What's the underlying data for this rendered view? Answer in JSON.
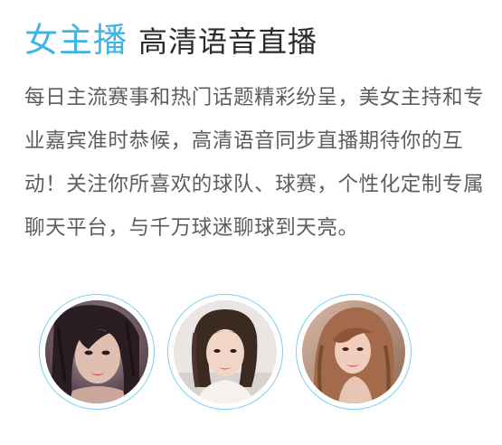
{
  "header": {
    "accent_title": "女主播",
    "main_title": "高清语音直播"
  },
  "description": "每日主流赛事和热门话题精彩纷呈，美女主持和专业嘉宾准时恭候，高清语音同步直播期待你的互动！关注你所喜欢的球队、球赛，个性化定制专属聊天平台，与千万球迷聊球到天亮。",
  "avatars": [
    {
      "icon": "anchor-avatar-1"
    },
    {
      "icon": "anchor-avatar-2"
    },
    {
      "icon": "anchor-avatar-3"
    }
  ],
  "colors": {
    "accent": "#3fb4e7",
    "ring": "#7fcdee",
    "title": "#2b2b2b",
    "body_text": "#5d5d5d"
  }
}
